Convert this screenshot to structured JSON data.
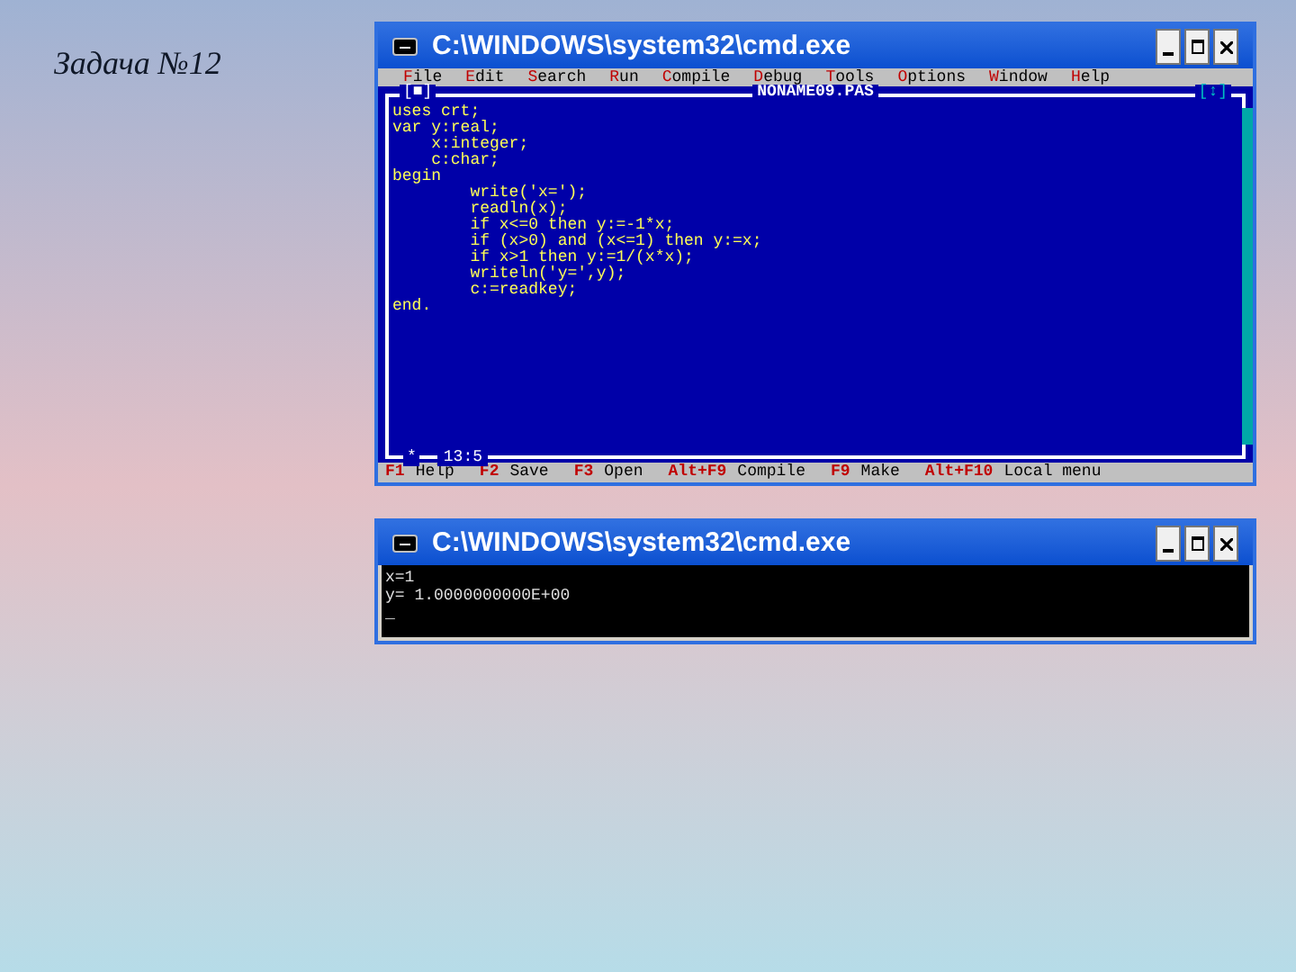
{
  "slide_title": "Задача №12",
  "editor_window": {
    "title": "C:\\WINDOWS\\system32\\cmd.exe",
    "menu": [
      "File",
      "Edit",
      "Search",
      "Run",
      "Compile",
      "Debug",
      "Tools",
      "Options",
      "Window",
      "Help"
    ],
    "frame_close": "[■]",
    "file_name": "NONAME09.PAS",
    "frame_zoom": "[↕]",
    "code": [
      "uses crt;",
      "var y:real;",
      "    x:integer;",
      "    c:char;",
      "begin",
      "        write('x=');",
      "        readln(x);",
      "        if x<=0 then y:=-1*x;",
      "        if (x>0) and (x<=1) then y:=x;",
      "        if x>1 then y:=1/(x*x);",
      "        writeln('y=',y);",
      "        c:=readkey;",
      "end."
    ],
    "frame_mark": "*",
    "cursor_position": "13:5",
    "status_bar": [
      {
        "key": "F1",
        "label": "Help"
      },
      {
        "key": "F2",
        "label": "Save"
      },
      {
        "key": "F3",
        "label": "Open"
      },
      {
        "key": "Alt+F9",
        "label": "Compile"
      },
      {
        "key": "F9",
        "label": "Make"
      },
      {
        "key": "Alt+F10",
        "label": "Local menu"
      }
    ]
  },
  "output_window": {
    "title": "C:\\WINDOWS\\system32\\cmd.exe",
    "lines": [
      "x=1",
      "y= 1.0000000000E+00",
      "_"
    ]
  }
}
